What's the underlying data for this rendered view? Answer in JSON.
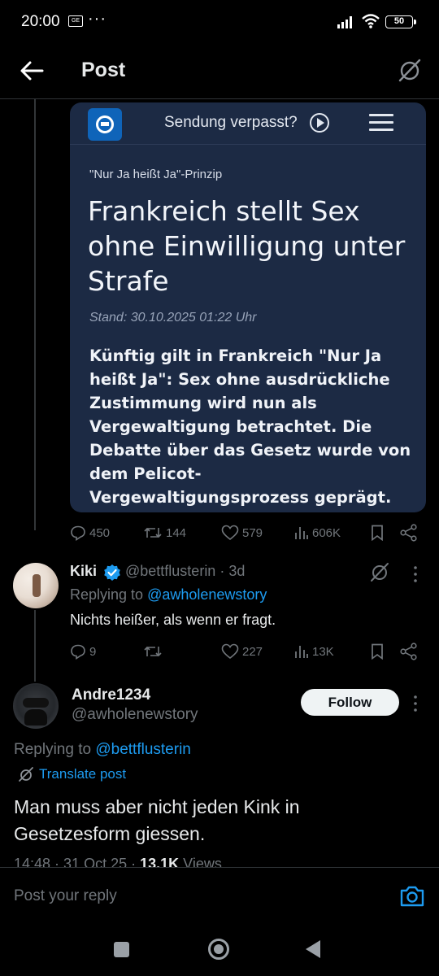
{
  "status_bar": {
    "time": "20:00",
    "sim_label": "GE",
    "dots": "···",
    "battery": "50"
  },
  "header": {
    "title": "Post"
  },
  "article": {
    "nav_label": "Sendung verpasst?",
    "kicker": "\"Nur Ja heißt Ja\"-Prinzip",
    "headline": "Frankreich stellt Sex ohne Einwilligung unter Strafe",
    "stand": "Stand: 30.10.2025 01:22 Uhr",
    "teaser": "Künftig gilt in Frankreich \"Nur Ja heißt Ja\": Sex ohne ausdrückliche Zustimmung wird nun als Vergewaltigung betrachtet. Die Debatte über das Gesetz wurde von dem Pelicot-Vergewaltigungsprozess geprägt."
  },
  "original_actions": {
    "replies": "450",
    "reposts": "144",
    "likes": "579",
    "views": "606K"
  },
  "reply": {
    "name": "Kiki",
    "handle": "@bettflusterin · 3d",
    "replying_prefix": "Replying to ",
    "replying_to": "@awholenewstory",
    "text": "Nichts heißer, als wenn er fragt.",
    "actions": {
      "replies": "9",
      "reposts": "",
      "likes": "227",
      "views": "13K"
    }
  },
  "main_post": {
    "name": "Andre1234",
    "handle": "@awholenewstory",
    "follow_label": "Follow",
    "replying_prefix": "Replying to ",
    "replying_to": "@bettflusterin",
    "translate_label": "Translate post",
    "text": "Man muss aber nicht jeden Kink in Gesetzesform giessen.",
    "meta_time": "14:48 · 31 Oct 25 · ",
    "meta_views_count": "13.1K",
    "meta_views_label": " Views"
  },
  "composer": {
    "placeholder": "Post your reply"
  },
  "colors": {
    "accent": "#1d9bf0",
    "card_bg": "#1c2a44",
    "muted": "#71767b",
    "text": "#e7e9ea"
  }
}
